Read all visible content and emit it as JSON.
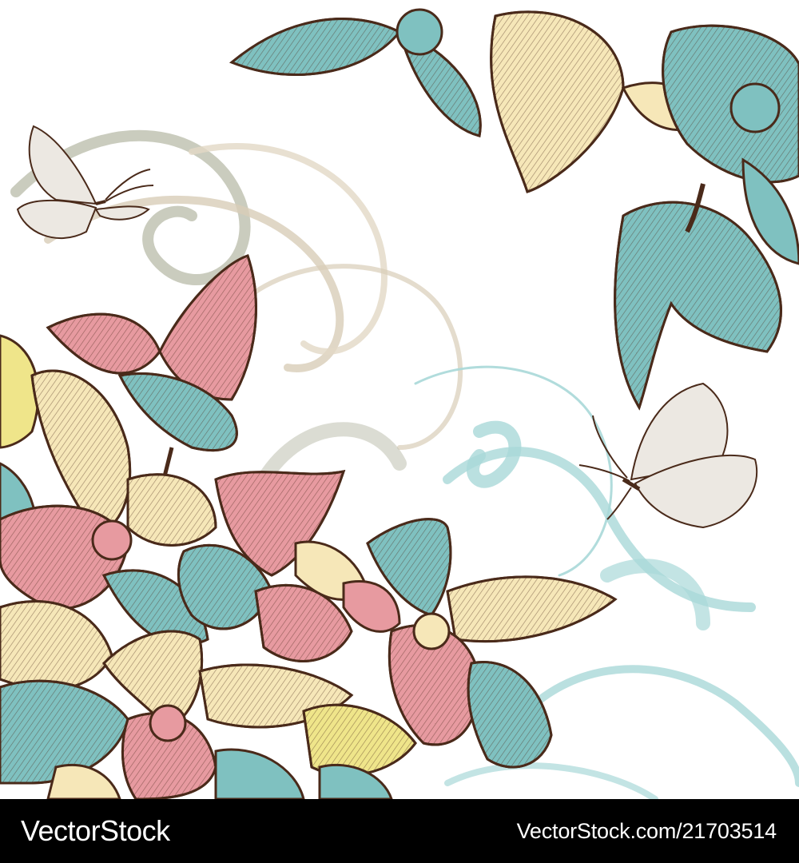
{
  "watermark": {
    "brand": "VectorStock",
    "credit": "VectorStock.com/21703514"
  },
  "palette": {
    "teal": "#7fc1c0",
    "pink": "#e79aa0",
    "cream": "#f6e7b8",
    "yellow": "#efe58a",
    "brown_outline": "#4a2a1a",
    "beige_swirl": "#d8cdb8",
    "grey_swirl": "#bdbfae",
    "blue_swirl": "#a9d8d8"
  },
  "artwork": {
    "subjects": [
      "orchid-flowers",
      "butterflies",
      "decorative-swirls"
    ]
  }
}
